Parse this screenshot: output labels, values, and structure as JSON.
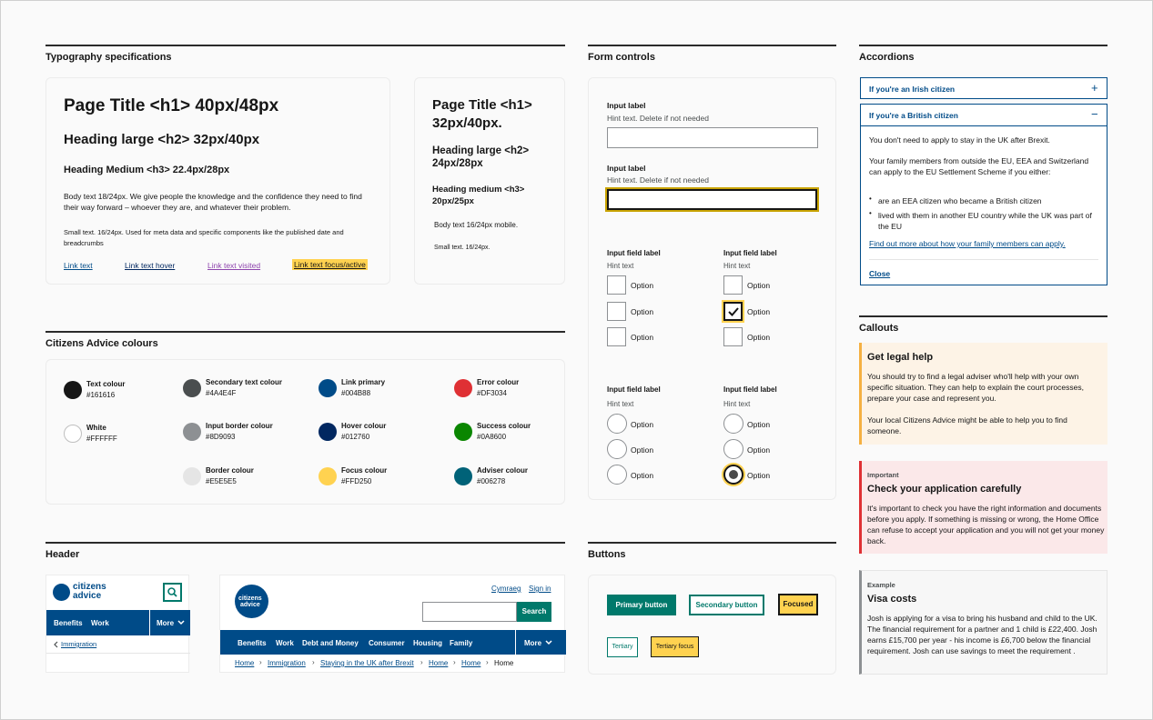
{
  "sections": {
    "typography": "Typography specifications",
    "colours": "Citizens Advice colours",
    "header": "Header",
    "form_controls": "Form controls",
    "buttons": "Buttons",
    "accordions": "Accordions",
    "callouts": "Callouts"
  },
  "typography": {
    "desktop": {
      "h1": "Page Title <h1> 40px/48px",
      "h2": "Heading large <h2> 32px/40px",
      "h3": "Heading Medium <h3> 22.4px/28px",
      "body": "Body text 18/24px. We give people the knowledge and the confidence they need to find their way forward – whoever they are, and whatever their problem.",
      "small": "Small text. 16/24px. Used for meta data and specific components like the published date and breadcrumbs",
      "links": [
        "Link text",
        "Link text hover",
        "Link text visited",
        "Link text focus/active"
      ]
    },
    "mobile": {
      "h1": "Page Title <h1> 32px/40px.",
      "h2": "Heading large <h2> 24px/28px",
      "h3": "Heading medium <h3> 20px/25px",
      "body": "Body text 16/24px mobile.",
      "small": "Small text. 16/24px."
    }
  },
  "colours": [
    {
      "name": "Text colour",
      "hex": "#161616",
      "color": "#161616"
    },
    {
      "name": "White",
      "hex": "#FFFFFF",
      "color": "#ffffff"
    },
    {
      "name": "Secondary text colour",
      "hex": "#4A4E4F",
      "color": "#4a4e4f"
    },
    {
      "name": "Input border colour",
      "hex": "#8D9093",
      "color": "#8d9093"
    },
    {
      "name": "Border colour",
      "hex": "#E5E5E5",
      "color": "#e5e5e5"
    },
    {
      "name": "Link primary",
      "hex": "#004B88",
      "color": "#004b88"
    },
    {
      "name": "Hover colour",
      "hex": "#012760",
      "color": "#012760"
    },
    {
      "name": "Focus colour",
      "hex": "#FFD250",
      "color": "#ffd250"
    },
    {
      "name": "Error colour",
      "hex": "#DF3034",
      "color": "#df3034"
    },
    {
      "name": "Success colour",
      "hex": "#0A8600",
      "color": "#0a8600"
    },
    {
      "name": "Adviser colour",
      "hex": "#006278",
      "color": "#006278"
    }
  ],
  "form": {
    "input1": {
      "label": "Input label",
      "hint": "Hint text. Delete if not needed"
    },
    "input2": {
      "label": "Input label",
      "hint": "Hint text. Delete if not needed"
    },
    "checkbox_group_a": {
      "label": "Input field label",
      "hint": "Hint text",
      "options": [
        "Option",
        "Option",
        "Option"
      ]
    },
    "checkbox_group_b": {
      "label": "Input field label",
      "hint": "Hint text",
      "options": [
        "Option",
        "Option",
        "Option"
      ]
    },
    "radio_group_a": {
      "label": "Input field label",
      "hint": "Hint text",
      "options": [
        "Option",
        "Option",
        "Option"
      ]
    },
    "radio_group_b": {
      "label": "Input field label",
      "hint": "Hint text",
      "options": [
        "Option",
        "Option",
        "Option"
      ]
    }
  },
  "buttons": {
    "primary": "Primary button",
    "secondary": "Secondary button",
    "focused": "Focused",
    "tertiary": "Tertiary",
    "tertiary_focus": "Tertiary focus"
  },
  "accordions": {
    "closed_title": "If you're an Irish citizen",
    "open_title": "If you're a British citizen",
    "p1": "You don't need to apply to stay in the UK after Brexit.",
    "p2": "Your family members from outside the EU, EEA and Switzerland can apply to the EU Settlement Scheme if you either:",
    "bullets": [
      "are an EEA citizen who became a British citizen",
      "lived with them in another EU country while the UK was part of the EU"
    ],
    "link": "Find out more about how your family members can apply.",
    "close": "Close",
    "plus": "+",
    "minus": "−"
  },
  "callouts": {
    "legal": {
      "title": "Get legal help",
      "p1": "You should try to find a legal adviser who'll help with your own specific situation. They can help to explain the court processes, prepare your case and represent you.",
      "p2": "Your local Citizens Advice might be able to help you to find someone."
    },
    "important": {
      "tag": "Important",
      "title": "Check your application carefully",
      "p": "It's important to check you have the right information and documents before you apply. If something is missing or wrong, the Home Office can refuse to accept your application and you will not get your money back."
    },
    "example": {
      "tag": "Example",
      "title": "Visa costs",
      "p": "Josh is applying for a visa to bring his husband and child to the UK. The financial requirement for a partner and 1 child is £22,400. Josh earns £15,700 per year - his income is £6,700 below the financial requirement. Josh can use savings to meet the requirement ."
    }
  },
  "header": {
    "mobile": {
      "logo_line1": "citizens",
      "logo_line2": "advice",
      "nav": [
        "Benefits",
        "Work"
      ],
      "more": "More",
      "back_crumb": "Immigration"
    },
    "desktop": {
      "logo_line1": "citizens",
      "logo_line2": "advice",
      "cymraeg": "Cymraeg",
      "sign_in": "Sign in",
      "search": "Search",
      "nav": [
        "Benefits",
        "Work",
        "Debt and Money",
        "Consumer",
        "Housing",
        "Family"
      ],
      "more": "More",
      "breadcrumbs": [
        "Home",
        "Immigration",
        "Staying in the UK after Brexit",
        "Home",
        "Home",
        "Home"
      ]
    }
  }
}
